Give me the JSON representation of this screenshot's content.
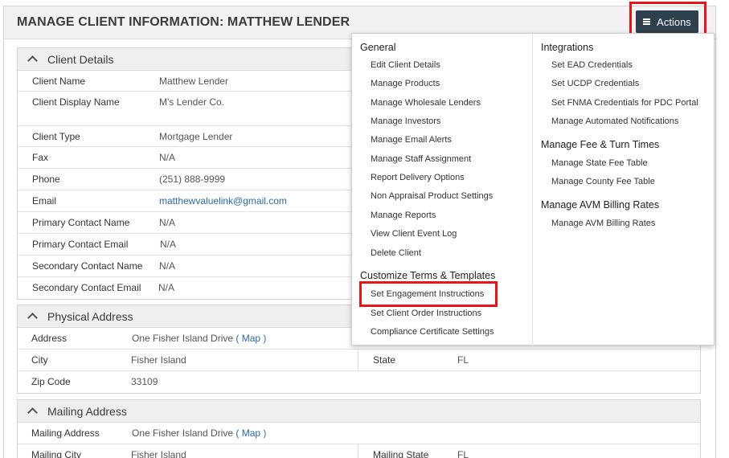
{
  "header": {
    "title": "MANAGE CLIENT INFORMATION: MATTHEW LENDER",
    "actions_label": "Actions"
  },
  "client_details": {
    "title": "Client Details",
    "rows": [
      {
        "label": "Client Name",
        "value": "Matthew Lender"
      },
      {
        "label": "Client Display Name",
        "value": "M's Lender Co."
      },
      {
        "label": "Client Type",
        "value": "Mortgage Lender"
      },
      {
        "label": "Fax",
        "value": "N/A"
      },
      {
        "label": "Phone",
        "value": "(251) 888-9999"
      },
      {
        "label": "Email",
        "value": "matthewvaluelink@gmail.com"
      },
      {
        "label": "Primary Contact Name",
        "value": "N/A"
      },
      {
        "label": "Primary Contact Email",
        "value": "N/A"
      },
      {
        "label": "Secondary Contact Name",
        "value": "N/A"
      },
      {
        "label": "Secondary Contact Email",
        "value": "N/A"
      }
    ]
  },
  "physical_address": {
    "title": "Physical Address",
    "address_label": "Address",
    "address_value": "One Fisher Island Drive",
    "map_label": "Map",
    "city_label": "City",
    "city_value": "Fisher Island",
    "state_label": "State",
    "state_value": "FL",
    "zip_label": "Zip Code",
    "zip_value": "33109"
  },
  "mailing_address": {
    "title": "Mailing Address",
    "address_label": "Mailing Address",
    "address_value": "One Fisher Island Drive",
    "map_label": "Map",
    "city_label": "Mailing City",
    "city_value": "Fisher Island",
    "state_label": "Mailing State",
    "state_value": "FL"
  },
  "actions_menu": {
    "general": {
      "heading": "General",
      "items": [
        "Edit Client Details",
        "Manage Products",
        "Manage Wholesale Lenders",
        "Manage Investors",
        "Manage Email Alerts",
        "Manage Staff Assignment",
        "Report Delivery Options",
        "Non Appraisal Product Settings",
        "Manage Reports",
        "View Client Event Log",
        "Delete Client"
      ]
    },
    "terms": {
      "heading": "Customize Terms & Templates",
      "items": [
        "Set Engagement Instructions",
        "Set Client Order Instructions",
        "Compliance Certificate Settings"
      ]
    },
    "integrations": {
      "heading": "Integrations",
      "items": [
        "Set EAD Credentials",
        "Set UCDP Credentials",
        "Set FNMA Credentials for PDC Portal",
        "Manage Automated Notifications"
      ]
    },
    "fee_turn": {
      "heading": "Manage Fee & Turn Times",
      "items": [
        "Manage State Fee Table",
        "Manage County Fee Table"
      ]
    },
    "avm": {
      "heading": "Manage AVM Billing Rates",
      "items": [
        "Manage AVM Billing Rates"
      ]
    }
  },
  "colors": {
    "highlight": "#e8141c",
    "actions_button": "#2e3f4d",
    "link": "#2a6aa8"
  }
}
